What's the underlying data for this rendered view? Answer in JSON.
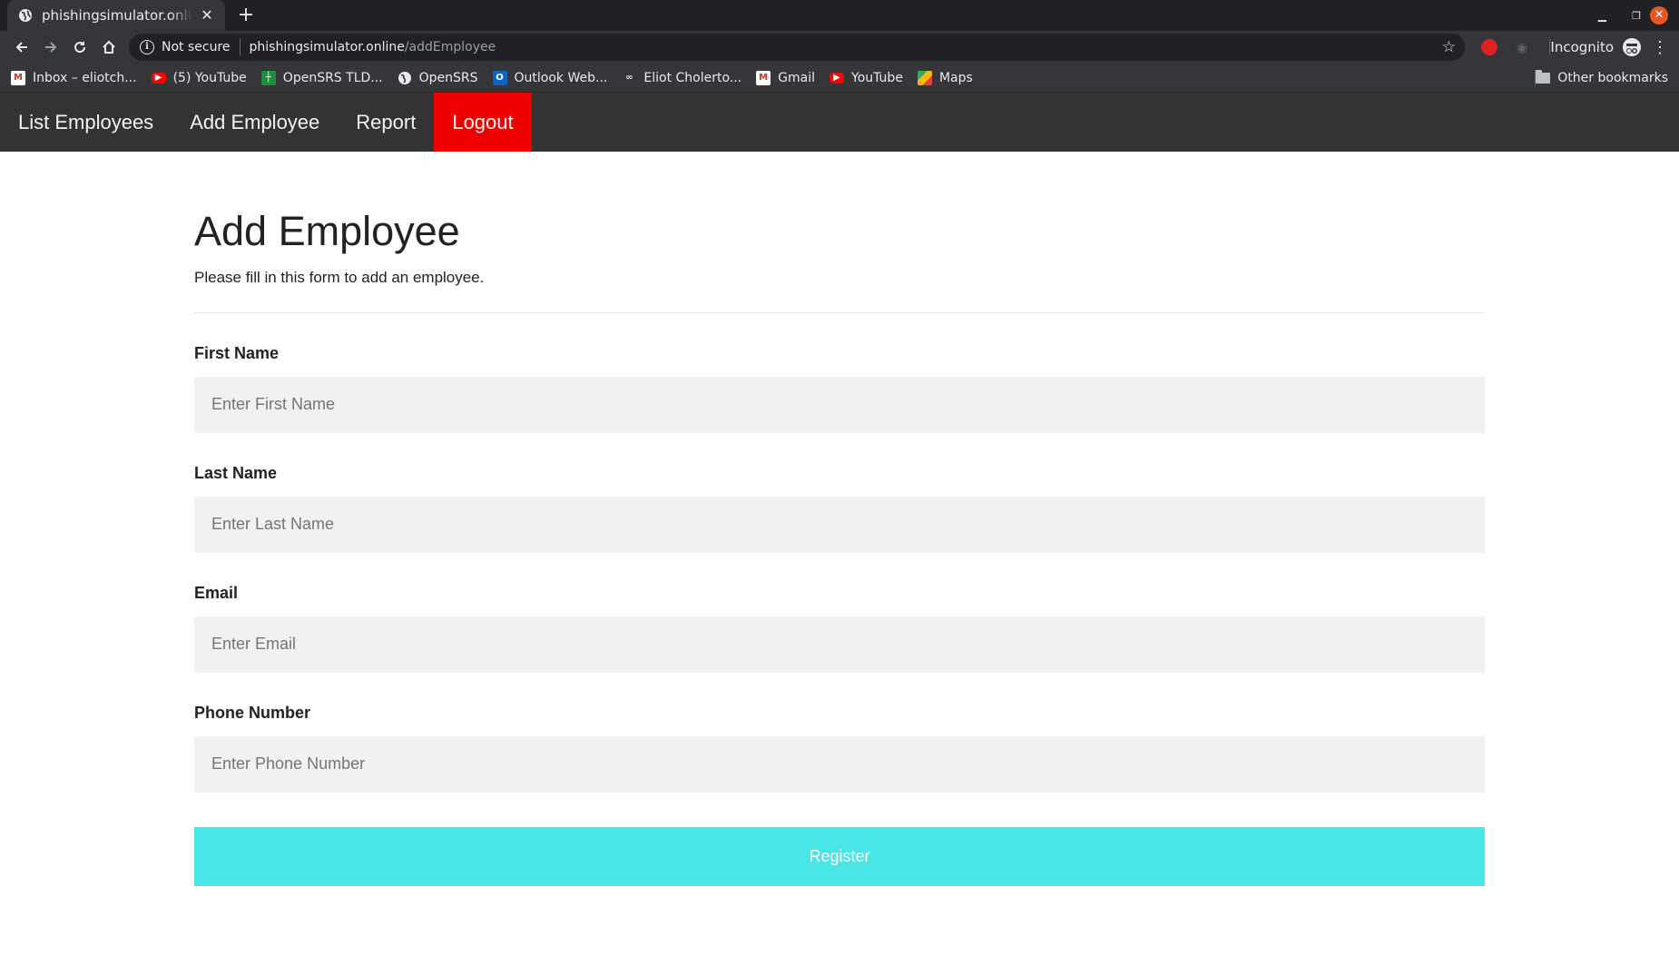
{
  "browser": {
    "tab_title": "phishingsimulator.online/addEmployee",
    "new_tab_symbol": "+",
    "not_secure_label": "Not secure",
    "url_host": "phishingsimulator.online",
    "url_path": "/addEmployee",
    "incognito_label": "Incognito",
    "bookmarks": [
      {
        "label": "Inbox – eliotch...",
        "icon": "gmail-icon"
      },
      {
        "label": "(5) YouTube",
        "icon": "youtube-icon"
      },
      {
        "label": "OpenSRS TLD...",
        "icon": "opensrs-tld-icon"
      },
      {
        "label": "OpenSRS",
        "icon": "globe-icon"
      },
      {
        "label": "Outlook Web...",
        "icon": "outlook-icon"
      },
      {
        "label": "Eliot Cholerto...",
        "icon": "glasses-icon"
      },
      {
        "label": "Gmail",
        "icon": "gmail-icon"
      },
      {
        "label": "YouTube",
        "icon": "youtube-icon"
      },
      {
        "label": "Maps",
        "icon": "maps-icon"
      }
    ],
    "other_bookmarks_label": "Other bookmarks"
  },
  "nav": {
    "items": [
      "List Employees",
      "Add Employee",
      "Report"
    ],
    "logout": "Logout",
    "logout_color": "#ef0000"
  },
  "form": {
    "title": "Add Employee",
    "subtitle": "Please fill in this form to add an employee.",
    "first_name": {
      "label": "First Name",
      "placeholder": "Enter First Name",
      "value": ""
    },
    "last_name": {
      "label": "Last Name",
      "placeholder": "Enter Last Name",
      "value": ""
    },
    "email": {
      "label": "Email",
      "placeholder": "Enter Email",
      "value": ""
    },
    "phone": {
      "label": "Phone Number",
      "placeholder": "Enter Phone Number",
      "value": ""
    },
    "register_label": "Register",
    "register_color": "#4ae5e7"
  }
}
